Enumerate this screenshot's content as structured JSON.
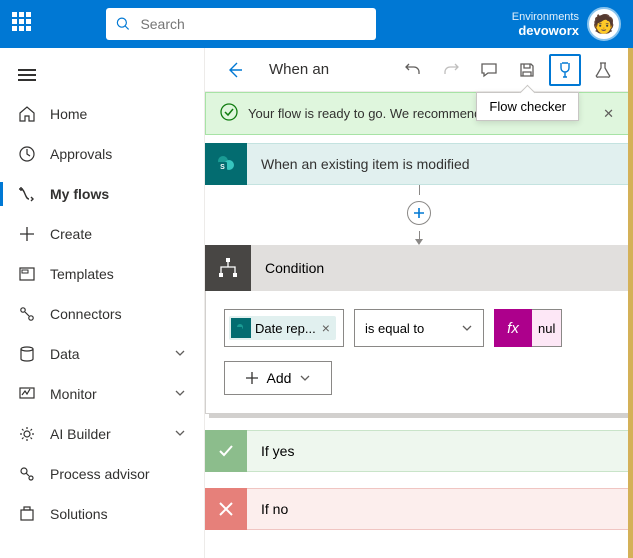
{
  "topbar": {
    "search_placeholder": "Search",
    "env_label": "Environments",
    "env_name": "devoworx"
  },
  "sidebar": {
    "items": [
      {
        "label": "Home"
      },
      {
        "label": "Approvals"
      },
      {
        "label": "My flows"
      },
      {
        "label": "Create"
      },
      {
        "label": "Templates"
      },
      {
        "label": "Connectors"
      },
      {
        "label": "Data"
      },
      {
        "label": "Monitor"
      },
      {
        "label": "AI Builder"
      },
      {
        "label": "Process advisor"
      },
      {
        "label": "Solutions"
      }
    ]
  },
  "cmdbar": {
    "title": "When an",
    "tooltip": "Flow checker"
  },
  "banner": {
    "text": "Your flow is ready to go. We recommend yo"
  },
  "flow": {
    "trigger_label": "When an existing item is modified",
    "condition_label": "Condition",
    "field_pill": "Date rep...",
    "operator": "is equal to",
    "fx_label": "fx",
    "value_text": "nul",
    "add_label": "Add",
    "yes_label": "If yes",
    "no_label": "If no"
  }
}
